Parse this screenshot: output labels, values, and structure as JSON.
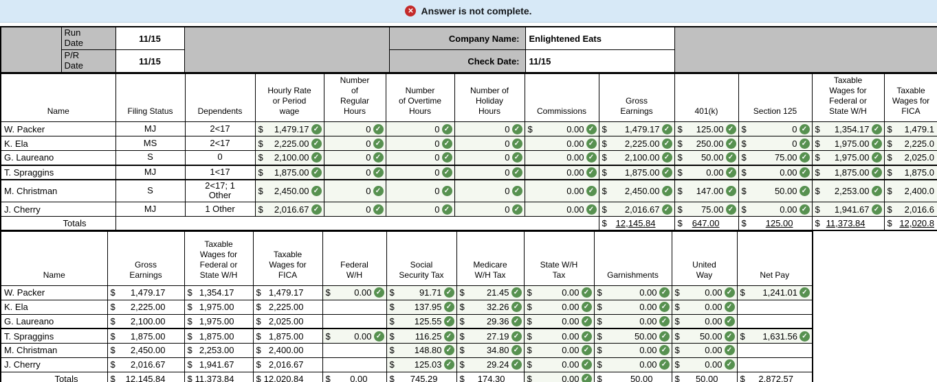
{
  "banner": {
    "message": "Answer is not complete.",
    "icon": "error-icon",
    "bg_color": "#d7e9f7",
    "icon_color": "#c42b2b"
  },
  "info": {
    "run_date_label": "Run\nDate",
    "run_date": "11/15",
    "pr_date_label": "P/R\nDate",
    "pr_date": "11/15",
    "company_name_label": "Company Name:",
    "company_name": "Enlightened Eats",
    "check_date_label": "Check Date:",
    "check_date": "11/15"
  },
  "check_icon_color": "#579150",
  "input_cell_color": "#f4f8f0",
  "table1": {
    "headers": [
      "Name",
      "Filing Status",
      "Dependents",
      "Hourly Rate\nor Period\nwage",
      "Number\nof\nRegular\nHours",
      "Number\nof Overtime\nHours",
      "Number of\nHoliday\nHours",
      "Commissions",
      "Gross\nEarnings",
      "401(k)",
      "Section 125",
      "Taxable\nWages for\nFederal or\nState W/H",
      "Taxable\nWages for\nFICA"
    ],
    "rows": [
      {
        "name": "W. Packer",
        "filing": "MJ",
        "dependents": "2<17",
        "cells": [
          {
            "d": 1,
            "v": "1,479.17",
            "c": 1,
            "in": 1
          },
          {
            "v": "0",
            "c": 1,
            "in": 1
          },
          {
            "v": "0",
            "c": 1,
            "in": 1
          },
          {
            "v": "0",
            "c": 1,
            "in": 1
          },
          {
            "d": 1,
            "v": "0.00",
            "c": 1,
            "in": 1
          },
          {
            "d": 1,
            "v": "1,479.17",
            "c": 1,
            "in": 1
          },
          {
            "d": 1,
            "v": "125.00",
            "c": 1,
            "in": 1
          },
          {
            "d": 1,
            "v": "0",
            "c": 1,
            "in": 1
          },
          {
            "d": 1,
            "v": "1,354.17",
            "c": 1,
            "in": 1
          },
          {
            "d": 1,
            "v": "1,479.1",
            "in": 1
          }
        ]
      },
      {
        "name": "K. Ela",
        "filing": "MS",
        "dependents": "2<17",
        "cells": [
          {
            "d": 1,
            "v": "2,225.00",
            "c": 1,
            "in": 1
          },
          {
            "v": "0",
            "c": 1,
            "in": 1
          },
          {
            "v": "0",
            "c": 1,
            "in": 1
          },
          {
            "v": "0",
            "c": 1,
            "in": 1
          },
          {
            "v": "0.00",
            "c": 1,
            "in": 1
          },
          {
            "d": 1,
            "v": "2,225.00",
            "c": 1,
            "in": 1
          },
          {
            "d": 1,
            "v": "250.00",
            "c": 1,
            "in": 1
          },
          {
            "d": 1,
            "v": "0",
            "c": 1,
            "in": 1
          },
          {
            "d": 1,
            "v": "1,975.00",
            "c": 1,
            "in": 1
          },
          {
            "d": 1,
            "v": "2,225.0",
            "in": 1
          }
        ]
      },
      {
        "name": "G. Laureano",
        "filing": "S",
        "dependents": "0",
        "cells": [
          {
            "d": 1,
            "v": "2,100.00",
            "c": 1,
            "in": 1
          },
          {
            "v": "0",
            "c": 1,
            "in": 1
          },
          {
            "v": "0",
            "c": 1,
            "in": 1
          },
          {
            "v": "0",
            "c": 1,
            "in": 1
          },
          {
            "v": "0.00",
            "c": 1,
            "in": 1
          },
          {
            "d": 1,
            "v": "2,100.00",
            "c": 1,
            "in": 1
          },
          {
            "d": 1,
            "v": "50.00",
            "c": 1,
            "in": 1
          },
          {
            "d": 1,
            "v": "75.00",
            "c": 1,
            "in": 1
          },
          {
            "d": 1,
            "v": "1,975.00",
            "c": 1,
            "in": 1
          },
          {
            "d": 1,
            "v": "2,025.0",
            "in": 1
          }
        ]
      },
      {
        "name": "T. Spraggins",
        "filing": "MJ",
        "dependents": "1<17",
        "cells": [
          {
            "d": 1,
            "v": "1,875.00",
            "c": 1,
            "in": 1
          },
          {
            "v": "0",
            "c": 1,
            "in": 1
          },
          {
            "v": "0",
            "c": 1,
            "in": 1
          },
          {
            "v": "0",
            "c": 1,
            "in": 1
          },
          {
            "v": "0.00",
            "c": 1,
            "in": 1
          },
          {
            "d": 1,
            "v": "1,875.00",
            "c": 1,
            "in": 1
          },
          {
            "d": 1,
            "v": "0.00",
            "c": 1,
            "in": 1
          },
          {
            "d": 1,
            "v": "0.00",
            "c": 1,
            "in": 1
          },
          {
            "d": 1,
            "v": "1,875.00",
            "c": 1,
            "in": 1
          },
          {
            "d": 1,
            "v": "1,875.0",
            "in": 1
          }
        ]
      },
      {
        "name": "M. Christman",
        "filing": "S",
        "dependents": "2<17; 1\nOther",
        "cells": [
          {
            "d": 1,
            "v": "2,450.00",
            "c": 1,
            "in": 1
          },
          {
            "v": "0",
            "c": 1,
            "in": 1
          },
          {
            "v": "0",
            "c": 1,
            "in": 1
          },
          {
            "v": "0",
            "c": 1,
            "in": 1
          },
          {
            "v": "0.00",
            "c": 1,
            "in": 1
          },
          {
            "d": 1,
            "v": "2,450.00",
            "c": 1,
            "in": 1
          },
          {
            "d": 1,
            "v": "147.00",
            "c": 1,
            "in": 1
          },
          {
            "d": 1,
            "v": "50.00",
            "c": 1,
            "in": 1
          },
          {
            "d": 1,
            "v": "2,253.00",
            "c": 1,
            "in": 1
          },
          {
            "d": 1,
            "v": "2,400.0",
            "in": 1
          }
        ]
      },
      {
        "name": "J. Cherry",
        "filing": "MJ",
        "dependents": "1 Other",
        "cells": [
          {
            "d": 1,
            "v": "2,016.67",
            "c": 1,
            "in": 1
          },
          {
            "v": "0",
            "c": 1,
            "in": 1
          },
          {
            "v": "0",
            "c": 1,
            "in": 1
          },
          {
            "v": "0",
            "c": 1,
            "in": 1
          },
          {
            "v": "0.00",
            "c": 1,
            "in": 1
          },
          {
            "d": 1,
            "v": "2,016.67",
            "c": 1,
            "in": 1
          },
          {
            "d": 1,
            "v": "75.00",
            "c": 1,
            "in": 1
          },
          {
            "d": 1,
            "v": "0.00",
            "c": 1,
            "in": 1
          },
          {
            "d": 1,
            "v": "1,941.67",
            "c": 1,
            "in": 1
          },
          {
            "d": 1,
            "v": "2,016.6",
            "in": 1
          }
        ]
      }
    ],
    "totals_label": "Totals",
    "totals": [
      {
        "d": 1,
        "v": "12,145.84",
        "u": 1
      },
      {
        "d": 1,
        "v": "647.00",
        "u": 1
      },
      {
        "d": 1,
        "v": "125.00",
        "u": 1
      },
      {
        "d": 1,
        "v": "11,373.84",
        "u": 1
      },
      {
        "d": 1,
        "v": "12,020.8",
        "u": 1
      }
    ]
  },
  "table2": {
    "headers": [
      "Name",
      "Gross\nEarnings",
      "Taxable\nWages for\nFederal or\nState W/H",
      "Taxable\nWages for\nFICA",
      "Federal\nW/H",
      "Social\nSecurity Tax",
      "Medicare\nW/H Tax",
      "State W/H\nTax",
      "Garnishments",
      "United\nWay",
      "Net Pay"
    ],
    "rows": [
      {
        "name": "W. Packer",
        "cells": [
          {
            "d": 1,
            "v": "1,479.17"
          },
          {
            "d": 1,
            "v": "1,354.17"
          },
          {
            "d": 1,
            "v": "1,479.17"
          },
          {
            "d": 1,
            "v": "0.00",
            "c": 1,
            "in": 1
          },
          {
            "d": 1,
            "v": "91.71",
            "c": 1,
            "in": 1
          },
          {
            "d": 1,
            "v": "21.45",
            "c": 1,
            "in": 1
          },
          {
            "d": 1,
            "v": "0.00",
            "c": 1,
            "in": 1
          },
          {
            "d": 1,
            "v": "0.00",
            "c": 1,
            "in": 1
          },
          {
            "d": 1,
            "v": "0.00",
            "c": 1,
            "in": 1
          },
          {
            "d": 1,
            "v": "1,241.01",
            "c": 1,
            "in": 1
          }
        ]
      },
      {
        "name": "K. Ela",
        "cells": [
          {
            "d": 1,
            "v": "2,225.00"
          },
          {
            "d": 1,
            "v": "1,975.00"
          },
          {
            "d": 1,
            "v": "2,225.00"
          },
          {},
          {
            "d": 1,
            "v": "137.95",
            "c": 1,
            "in": 1
          },
          {
            "d": 1,
            "v": "32.26",
            "c": 1,
            "in": 1
          },
          {
            "d": 1,
            "v": "0.00",
            "c": 1,
            "in": 1
          },
          {
            "d": 1,
            "v": "0.00",
            "c": 1,
            "in": 1
          },
          {
            "d": 1,
            "v": "0.00",
            "c": 1,
            "in": 1
          },
          {}
        ]
      },
      {
        "name": "G. Laureano",
        "cells": [
          {
            "d": 1,
            "v": "2,100.00"
          },
          {
            "d": 1,
            "v": "1,975.00"
          },
          {
            "d": 1,
            "v": "2,025.00"
          },
          {},
          {
            "d": 1,
            "v": "125.55",
            "c": 1,
            "in": 1
          },
          {
            "d": 1,
            "v": "29.36",
            "c": 1,
            "in": 1
          },
          {
            "d": 1,
            "v": "0.00",
            "c": 1,
            "in": 1
          },
          {
            "d": 1,
            "v": "0.00",
            "c": 1,
            "in": 1
          },
          {
            "d": 1,
            "v": "0.00",
            "c": 1,
            "in": 1
          },
          {}
        ]
      },
      {
        "name": "T. Spraggins",
        "cells": [
          {
            "d": 1,
            "v": "1,875.00"
          },
          {
            "d": 1,
            "v": "1,875.00"
          },
          {
            "d": 1,
            "v": "1,875.00"
          },
          {
            "d": 1,
            "v": "0.00",
            "c": 1,
            "in": 1
          },
          {
            "d": 1,
            "v": "116.25",
            "c": 1,
            "in": 1
          },
          {
            "d": 1,
            "v": "27.19",
            "c": 1,
            "in": 1
          },
          {
            "d": 1,
            "v": "0.00",
            "c": 1,
            "in": 1
          },
          {
            "d": 1,
            "v": "50.00",
            "c": 1,
            "in": 1
          },
          {
            "d": 1,
            "v": "50.00",
            "c": 1,
            "in": 1
          },
          {
            "d": 1,
            "v": "1,631.56",
            "c": 1,
            "in": 1
          }
        ]
      },
      {
        "name": "M. Christman",
        "cells": [
          {
            "d": 1,
            "v": "2,450.00"
          },
          {
            "d": 1,
            "v": "2,253.00"
          },
          {
            "d": 1,
            "v": "2,400.00"
          },
          {},
          {
            "d": 1,
            "v": "148.80",
            "c": 1,
            "in": 1
          },
          {
            "d": 1,
            "v": "34.80",
            "c": 1,
            "in": 1
          },
          {
            "d": 1,
            "v": "0.00",
            "c": 1,
            "in": 1
          },
          {
            "d": 1,
            "v": "0.00",
            "c": 1,
            "in": 1
          },
          {
            "d": 1,
            "v": "0.00",
            "c": 1,
            "in": 1
          },
          {}
        ]
      },
      {
        "name": "J. Cherry",
        "cells": [
          {
            "d": 1,
            "v": "2,016.67"
          },
          {
            "d": 1,
            "v": "1,941.67"
          },
          {
            "d": 1,
            "v": "2,016.67"
          },
          {},
          {
            "d": 1,
            "v": "125.03",
            "c": 1,
            "in": 1
          },
          {
            "d": 1,
            "v": "29.24",
            "c": 1,
            "in": 1
          },
          {
            "d": 1,
            "v": "0.00",
            "c": 1,
            "in": 1
          },
          {
            "d": 1,
            "v": "0.00",
            "c": 1,
            "in": 1
          },
          {
            "d": 1,
            "v": "0.00",
            "c": 1,
            "in": 1
          },
          {}
        ]
      }
    ],
    "totals_label": "Totals",
    "totals": [
      {
        "d": 1,
        "v": "12,145.84",
        "u": 1
      },
      {
        "d": 1,
        "v": "11,373.84",
        "u": 1
      },
      {
        "d": 1,
        "v": "12,020.84",
        "u": 1
      },
      {
        "d": 1,
        "v": "0.00",
        "u": 1
      },
      {
        "d": 1,
        "v": "745.29",
        "u": 1
      },
      {
        "d": 1,
        "v": "174.30",
        "u": 1
      },
      {
        "d": 1,
        "v": "0.00",
        "u": 1,
        "c": 1,
        "in": 1
      },
      {
        "d": 1,
        "v": "50.00",
        "u": 1
      },
      {
        "d": 1,
        "v": "50.00",
        "u": 1
      },
      {
        "d": 1,
        "v": "2,872.57",
        "u": 1
      }
    ]
  }
}
